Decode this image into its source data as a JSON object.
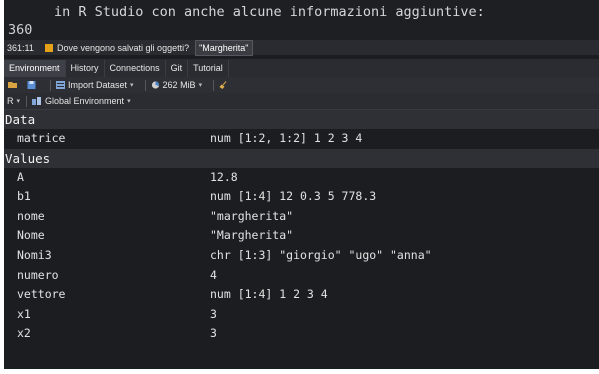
{
  "editor": {
    "line_text": "in R Studio con anche alcune informazioni aggiuntive:",
    "line_number": "360"
  },
  "status": {
    "position": "361:11",
    "function_icon": "function-icon",
    "function_label": "Dove vengono salvati gli oggetti?",
    "tooltip": "\"Margherita\""
  },
  "tabs": [
    {
      "label": "Environment",
      "active": true
    },
    {
      "label": "History"
    },
    {
      "label": "Connections"
    },
    {
      "label": "Git"
    },
    {
      "label": "Tutorial"
    }
  ],
  "toolbar": {
    "import_label": "Import Dataset",
    "memory_label": "262 MiB"
  },
  "envbar": {
    "language": "R",
    "scope": "Global Environment"
  },
  "sections": [
    {
      "title": "Data",
      "rows": [
        {
          "name": "matrice",
          "value": "num [1:2, 1:2] 1 2 3 4"
        }
      ]
    },
    {
      "title": "Values",
      "rows": [
        {
          "name": "A",
          "value": "12.8"
        },
        {
          "name": "b1",
          "value": "num [1:4] 12 0.3 5 778.3"
        },
        {
          "name": "nome",
          "value": "\"margherita\""
        },
        {
          "name": "Nome",
          "value": "\"Margherita\""
        },
        {
          "name": "Nomi3",
          "value": "chr [1:3] \"giorgio\" \"ugo\" \"anna\""
        },
        {
          "name": "numero",
          "value": "4"
        },
        {
          "name": "vettore",
          "value": "num [1:4] 1 2 3 4"
        },
        {
          "name": "x1",
          "value": "3"
        },
        {
          "name": "x2",
          "value": "3"
        }
      ]
    }
  ],
  "colors": {
    "background": "#1c1d21",
    "section_header": "#2f3035",
    "active_tab": "#3e4047",
    "function_icon": "#e3a21a"
  }
}
